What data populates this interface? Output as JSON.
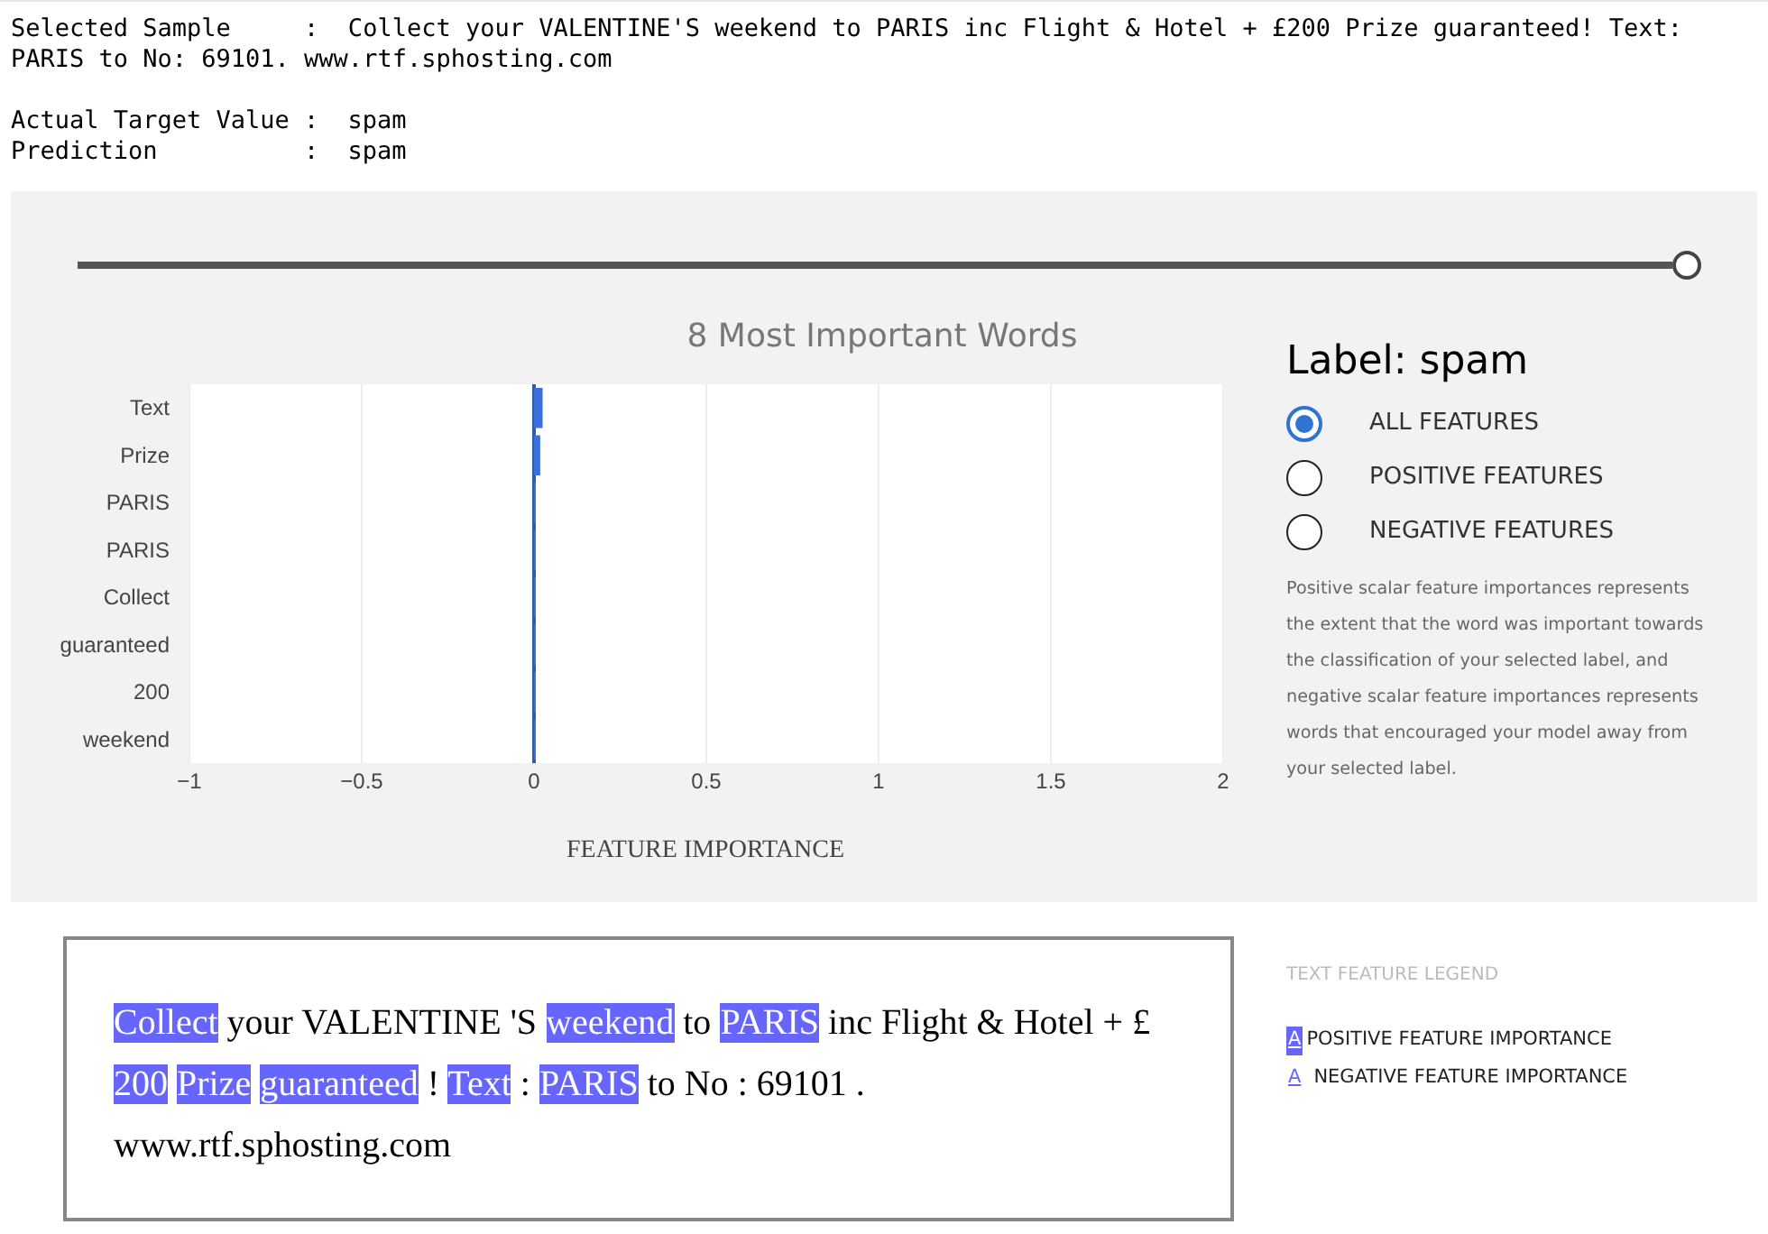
{
  "sample_info": [
    {
      "label": "Selected Sample     :",
      "value": "Collect your VALENTINE'S weekend to PARIS inc Flight & Hotel + £200 Prize guaranteed! Text: PARIS to No: 69101. www.rtf.sphosting.com"
    },
    {
      "label": "Actual Target Value :",
      "value": "spam"
    },
    {
      "label": "Prediction          :",
      "value": "spam"
    }
  ],
  "slider": {
    "level": 1
  },
  "chart_data": {
    "type": "bar",
    "orientation": "horizontal",
    "title": "8 Most Important Words",
    "xlabel": "FEATURE IMPORTANCE",
    "categories": [
      "Text",
      "Prize",
      "PARIS",
      "PARIS",
      "Collect",
      "guaranteed",
      "200",
      "weekend"
    ],
    "grid": true,
    "ref_lines": [
      {
        "axis": "x",
        "value": 0,
        "color": "#2f5f9a"
      }
    ],
    "series": [
      {
        "color": "#3b6fdc",
        "values": [
          0.025,
          0.018,
          0.004,
          0.004,
          0.003,
          0.003,
          0.003,
          0.003
        ]
      }
    ],
    "xlim": [
      -1,
      2
    ],
    "xticks": [
      {
        "value": -1,
        "label": "−1"
      },
      {
        "value": -0.5,
        "label": "−0.5"
      },
      0,
      0.5,
      1,
      1.5,
      2
    ]
  },
  "label_heading": "Label: spam",
  "filter_options": [
    {
      "label": "ALL FEATURES",
      "selected": true
    },
    {
      "label": "POSITIVE FEATURES",
      "selected": false
    },
    {
      "label": "NEGATIVE FEATURES",
      "selected": false
    }
  ],
  "description": "Positive scalar feature importances represents the extent that the word was important towards the classification of your selected label, and negative scalar feature importances represents words that encouraged your model away from your selected label.",
  "tokens": [
    {
      "text": "Collect",
      "highlighted": true
    },
    {
      "text": "your",
      "highlighted": false
    },
    {
      "text": "VALENTINE",
      "highlighted": false
    },
    {
      "text": "'S",
      "highlighted": false
    },
    {
      "text": "weekend",
      "highlighted": true
    },
    {
      "text": "to",
      "highlighted": false
    },
    {
      "text": "PARIS",
      "highlighted": true
    },
    {
      "text": "inc",
      "highlighted": false
    },
    {
      "text": "Flight",
      "highlighted": false
    },
    {
      "text": "&",
      "highlighted": false
    },
    {
      "text": "Hotel",
      "highlighted": false
    },
    {
      "text": "+",
      "highlighted": false
    },
    {
      "text": "£",
      "highlighted": false
    },
    {
      "text": "200",
      "highlighted": true
    },
    {
      "text": "Prize",
      "highlighted": true
    },
    {
      "text": "guaranteed",
      "highlighted": true
    },
    {
      "text": "!",
      "highlighted": false
    },
    {
      "text": "Text",
      "highlighted": true
    },
    {
      "text": ":",
      "highlighted": false
    },
    {
      "text": "PARIS",
      "highlighted": true
    },
    {
      "text": "to",
      "highlighted": false
    },
    {
      "text": "No",
      "highlighted": false
    },
    {
      "text": ":",
      "highlighted": false
    },
    {
      "text": "69101",
      "highlighted": false
    },
    {
      "text": ".",
      "highlighted": false
    },
    {
      "text": "www.rtf.sphosting.com",
      "highlighted": false
    }
  ],
  "legend": {
    "title": "TEXT FEATURE LEGEND",
    "items": [
      {
        "kind": "positive",
        "sample": "A",
        "label": "POSITIVE FEATURE IMPORTANCE"
      },
      {
        "kind": "negative",
        "sample": "A",
        "label": "NEGATIVE FEATURE IMPORTANCE"
      }
    ]
  }
}
